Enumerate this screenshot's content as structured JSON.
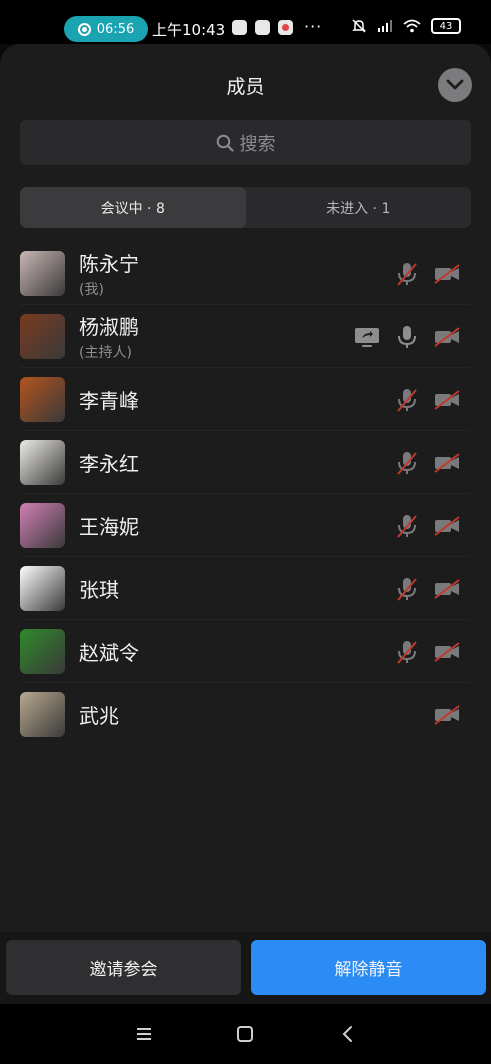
{
  "status_bar": {
    "call_timer": "06:56",
    "clock": "上午10:43",
    "battery": "43",
    "more": "···"
  },
  "sheet": {
    "title": "成员",
    "search_placeholder": "搜索",
    "tabs": [
      {
        "label": "会议中 · 8",
        "active": true
      },
      {
        "label": "未进入 · 1",
        "active": false
      }
    ]
  },
  "members": [
    {
      "name": "陈永宁",
      "role": "(我)",
      "share": false,
      "mic": "muted",
      "video": "off",
      "avatar_color": "#c9b7b5"
    },
    {
      "name": "杨淑鹏",
      "role": "(主持人)",
      "share": true,
      "mic": "on",
      "video": "off",
      "avatar_color": "#7a3a1f"
    },
    {
      "name": "李青峰",
      "role": "",
      "share": false,
      "mic": "muted",
      "video": "off",
      "avatar_color": "#b4541c"
    },
    {
      "name": "李永红",
      "role": "",
      "share": false,
      "mic": "muted",
      "video": "off",
      "avatar_color": "#ecebe6"
    },
    {
      "name": "王海妮",
      "role": "",
      "share": false,
      "mic": "muted",
      "video": "off",
      "avatar_color": "#d27fb6"
    },
    {
      "name": "张琪",
      "role": "",
      "share": false,
      "mic": "muted",
      "video": "off",
      "avatar_color": "#ffffff"
    },
    {
      "name": "赵斌令",
      "role": "",
      "share": false,
      "mic": "muted",
      "video": "off",
      "avatar_color": "#2f8a2a"
    },
    {
      "name": "武兆",
      "role": "",
      "share": false,
      "mic": "none",
      "video": "off",
      "avatar_color": "#b9a98e"
    }
  ],
  "footer": {
    "invite_label": "邀请参会",
    "unmute_label": "解除静音"
  },
  "colors": {
    "accent": "#2c8cf5",
    "timer": "#1aa3b0",
    "muted_slash": "#c0392b"
  }
}
